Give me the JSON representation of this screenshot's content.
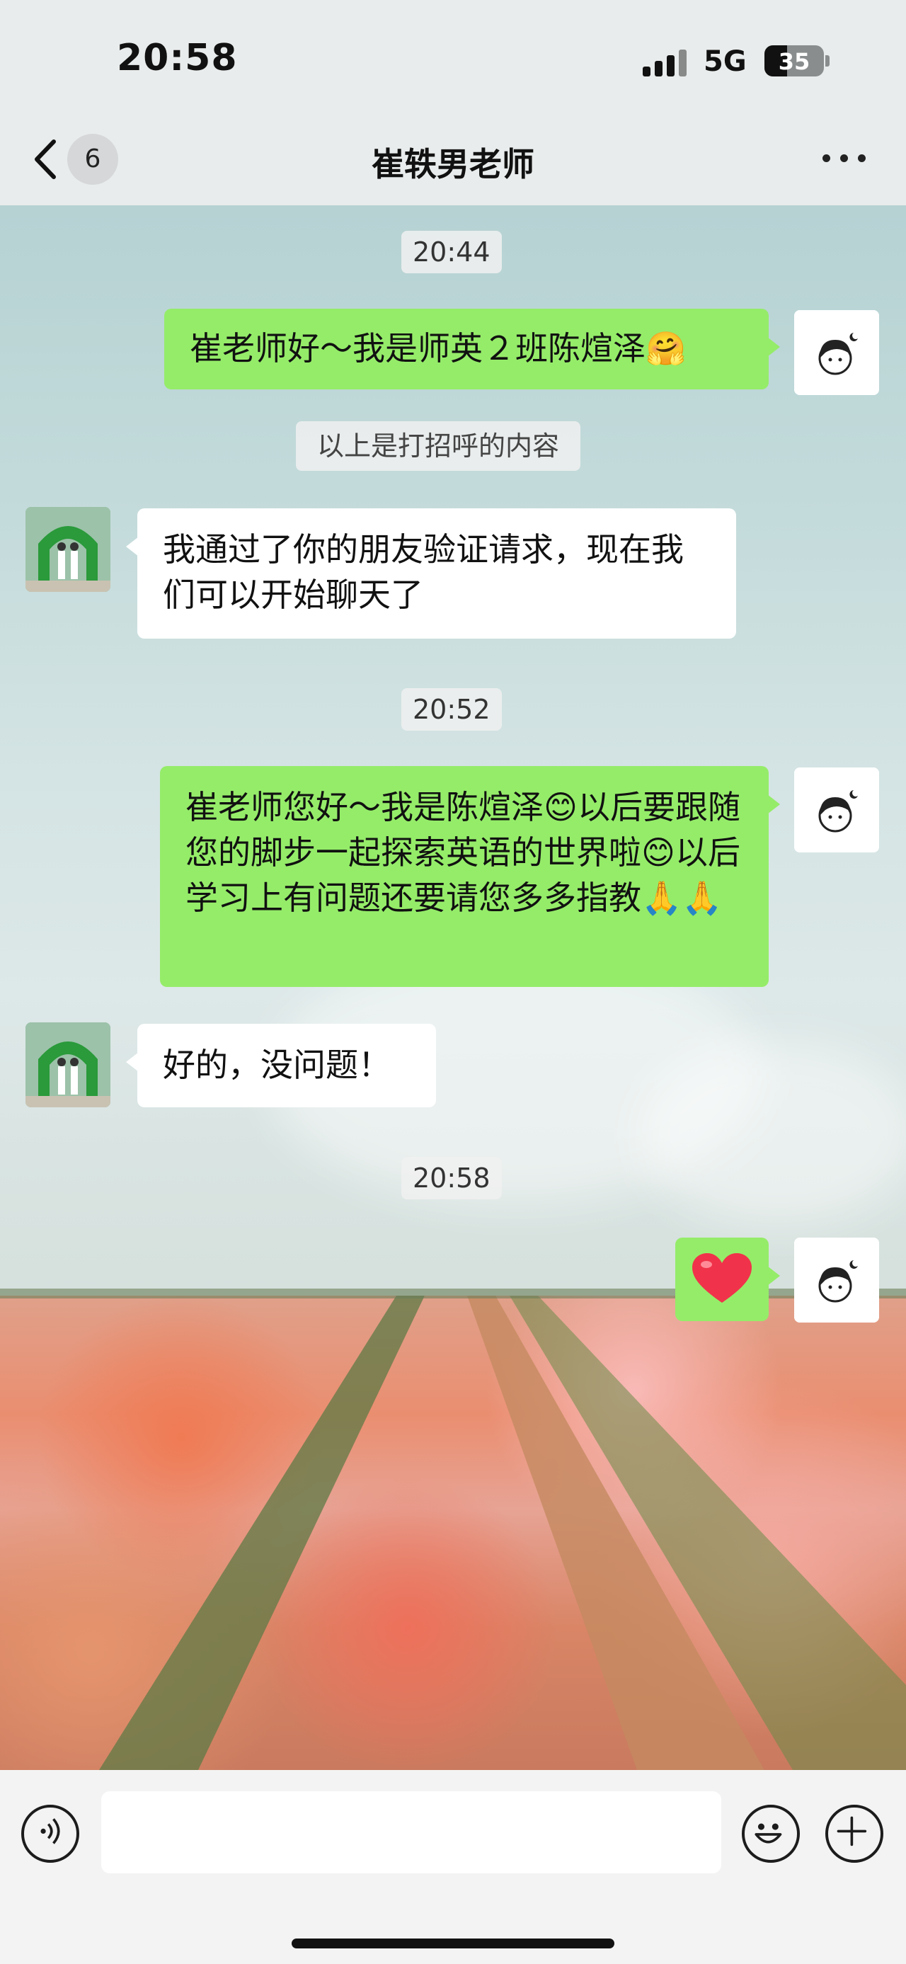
{
  "status_bar": {
    "time": "20:58",
    "network": "5G",
    "battery": "35"
  },
  "header": {
    "back_icon": "chevron-left-icon",
    "unread_count": "6",
    "title": "崔轶男老师",
    "more_icon": "more-dots-icon"
  },
  "chat": {
    "time_chips": [
      "20:44",
      "20:52",
      "20:58"
    ],
    "system_note": "以上是打招呼的内容",
    "messages": [
      {
        "from": "self",
        "text": "崔老师好～我是师英２班陈煊泽🤗"
      },
      {
        "from": "teacher",
        "text": "我通过了你的朋友验证请求，现在我们可以开始聊天了"
      },
      {
        "from": "self",
        "text": "崔老师您好～我是陈煊泽😊以后要跟随您的脚步一起探索英语的世界啦😊以后学习上有问题还要请您多多指教🙏🙏"
      },
      {
        "from": "teacher",
        "text": "好的，没问题！"
      },
      {
        "from": "self",
        "text": "❤️"
      }
    ]
  },
  "input_bar": {
    "voice_icon": "voice-icon",
    "emoji_icon": "emoji-icon",
    "plus_icon": "plus-icon",
    "placeholder": ""
  },
  "colors": {
    "self_bubble": "#95ec69",
    "other_bubble": "#ffffff",
    "accent_heart": "#f0334a"
  }
}
